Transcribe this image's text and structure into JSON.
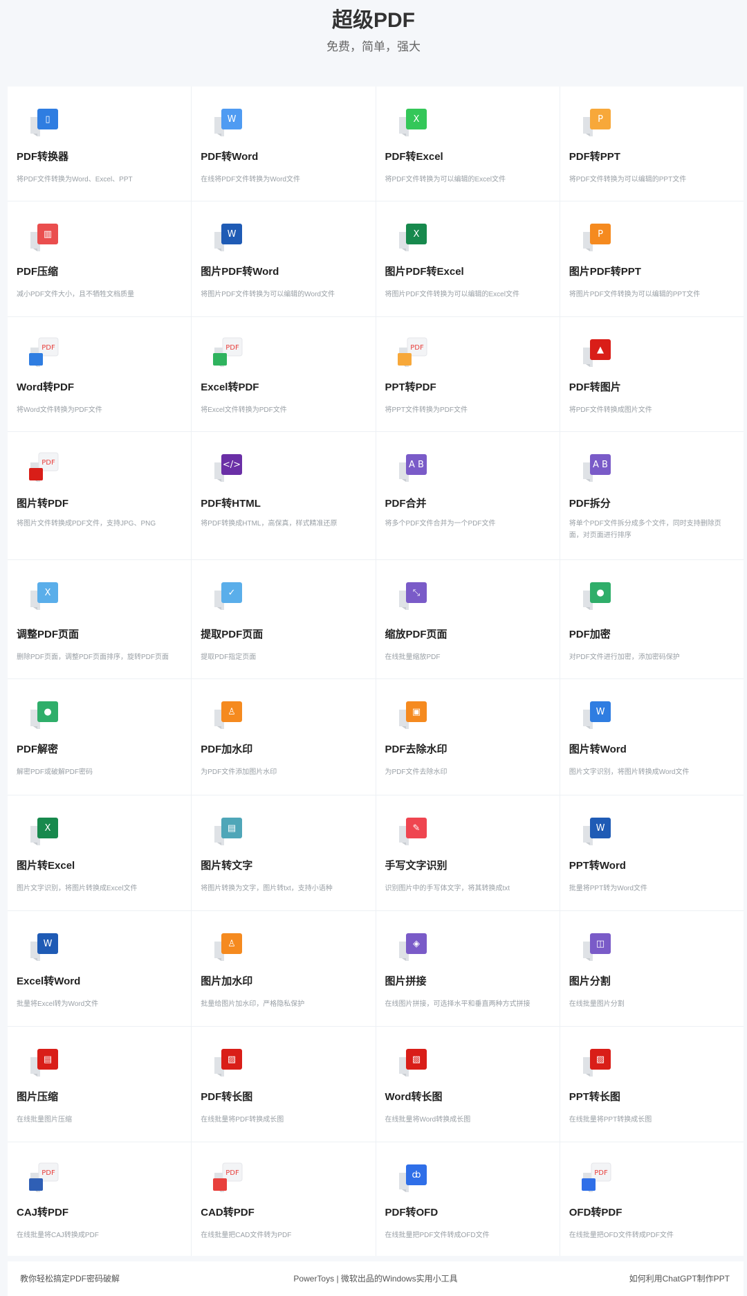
{
  "header": {
    "title": "超级PDF",
    "subtitle": "免费，简单，强大"
  },
  "tools": [
    {
      "key": "pdf-converter",
      "title": "PDF转换器",
      "desc": "将PDF文件转换为Word、Excel、PPT",
      "icon": "office-icon",
      "color": "#2f7de1",
      "glyph": "▯"
    },
    {
      "key": "pdf-to-word",
      "title": "PDF转Word",
      "desc": "在线将PDF文件转换为Word文件",
      "icon": "word-icon",
      "color": "#4f9bf2",
      "glyph": "W"
    },
    {
      "key": "pdf-to-excel",
      "title": "PDF转Excel",
      "desc": "将PDF文件转换为可以编辑的Excel文件",
      "icon": "excel-icon",
      "color": "#34c759",
      "glyph": "X"
    },
    {
      "key": "pdf-to-ppt",
      "title": "PDF转PPT",
      "desc": "将PDF文件转换为可以编辑的PPT文件",
      "icon": "ppt-icon",
      "color": "#f7a83a",
      "glyph": "P"
    },
    {
      "key": "pdf-compress",
      "title": "PDF压缩",
      "desc": "减小PDF文件大小，且不牺牲文档质量",
      "icon": "compress-icon",
      "color": "#ea4e4e",
      "glyph": "▥"
    },
    {
      "key": "image-pdf-to-word",
      "title": "图片PDF转Word",
      "desc": "将图片PDF文件转换为可以编辑的Word文件",
      "icon": "word-icon",
      "color": "#1f5bb5",
      "glyph": "W"
    },
    {
      "key": "image-pdf-to-excel",
      "title": "图片PDF转Excel",
      "desc": "将图片PDF文件转换为可以编辑的Excel文件",
      "icon": "excel-icon",
      "color": "#17894d",
      "glyph": "X"
    },
    {
      "key": "image-pdf-to-ppt",
      "title": "图片PDF转PPT",
      "desc": "将图片PDF文件转换为可以编辑的PPT文件",
      "icon": "ppt-icon",
      "color": "#f58a1f",
      "glyph": "P"
    },
    {
      "key": "word-to-pdf",
      "title": "Word转PDF",
      "desc": "将Word文件转换为PDF文件",
      "icon": "pdf-badge-icon",
      "color": "#2f7de1",
      "glyph": "PDF"
    },
    {
      "key": "excel-to-pdf",
      "title": "Excel转PDF",
      "desc": "将Excel文件转换为PDF文件",
      "icon": "pdf-badge-icon",
      "color": "#2fb35e",
      "glyph": "PDF"
    },
    {
      "key": "ppt-to-pdf",
      "title": "PPT转PDF",
      "desc": "将PPT文件转换为PDF文件",
      "icon": "pdf-badge-icon",
      "color": "#f7a83a",
      "glyph": "PDF"
    },
    {
      "key": "pdf-to-image",
      "title": "PDF转图片",
      "desc": "将PDF文件转换成图片文件",
      "icon": "image-icon",
      "color": "#d91e18",
      "glyph": "▲"
    },
    {
      "key": "image-to-pdf",
      "title": "图片转PDF",
      "desc": "将图片文件转换成PDF文件，支持JPG、PNG",
      "icon": "pdf-badge-icon",
      "color": "#d91e18",
      "glyph": "PDF"
    },
    {
      "key": "pdf-to-html",
      "title": "PDF转HTML",
      "desc": "将PDF转换成HTML，高保真，样式精准还原",
      "icon": "code-icon",
      "color": "#6a2fa6",
      "glyph": "</>"
    },
    {
      "key": "pdf-merge",
      "title": "PDF合并",
      "desc": "将多个PDF文件合并为一个PDF文件",
      "icon": "merge-icon",
      "color": "#7a5bc8",
      "glyph": "A B"
    },
    {
      "key": "pdf-split",
      "title": "PDF拆分",
      "desc": "将单个PDF文件拆分成多个文件，同时支持删除页面，对页面进行排序",
      "icon": "split-icon",
      "color": "#7a5bc8",
      "glyph": "A B"
    },
    {
      "key": "adjust-pdf-pages",
      "title": "调整PDF页面",
      "desc": "删除PDF页面，调整PDF页面排序，旋转PDF页面",
      "icon": "adjust-pages-icon",
      "color": "#5aaeea",
      "glyph": "X"
    },
    {
      "key": "extract-pdf-pages",
      "title": "提取PDF页面",
      "desc": "提取PDF指定页面",
      "icon": "extract-pages-icon",
      "color": "#5aaeea",
      "glyph": "✓"
    },
    {
      "key": "resize-pdf-pages",
      "title": "缩放PDF页面",
      "desc": "在线批量缩放PDF",
      "icon": "shrink-icon",
      "color": "#7a5bc8",
      "glyph": "⤡"
    },
    {
      "key": "pdf-encrypt",
      "title": "PDF加密",
      "desc": "对PDF文件进行加密，添加密码保护",
      "icon": "shield-icon",
      "color": "#2fae6a",
      "glyph": "●"
    },
    {
      "key": "pdf-decrypt",
      "title": "PDF解密",
      "desc": "解密PDF或破解PDF密码",
      "icon": "unlock-icon",
      "color": "#2fae6a",
      "glyph": "●"
    },
    {
      "key": "pdf-watermark",
      "title": "PDF加水印",
      "desc": "为PDF文件添加图片水印",
      "icon": "stamp-icon",
      "color": "#f58a1f",
      "glyph": "♙"
    },
    {
      "key": "pdf-remove-watermark",
      "title": "PDF去除水印",
      "desc": "为PDF文件去除水印",
      "icon": "eraser-icon",
      "color": "#f58a1f",
      "glyph": "▣"
    },
    {
      "key": "image-to-word",
      "title": "图片转Word",
      "desc": "图片文字识别，将图片转换成Word文件",
      "icon": "word-icon",
      "color": "#2f7de1",
      "glyph": "W"
    },
    {
      "key": "image-to-excel",
      "title": "图片转Excel",
      "desc": "图片文字识别，将图片转换成Excel文件",
      "icon": "excel-icon",
      "color": "#17894d",
      "glyph": "X"
    },
    {
      "key": "image-to-text",
      "title": "图片转文字",
      "desc": "将图片转换为文字，图片转txt，支持小语种",
      "icon": "text-doc-icon",
      "color": "#4fa6b8",
      "glyph": "▤"
    },
    {
      "key": "handwriting-ocr",
      "title": "手写文字识别",
      "desc": "识别图片中的手写体文字，将其转换成txt",
      "icon": "pen-icon",
      "color": "#ef4550",
      "glyph": "✎"
    },
    {
      "key": "ppt-to-word",
      "title": "PPT转Word",
      "desc": "批量将PPT转为Word文件",
      "icon": "word-icon",
      "color": "#1f5bb5",
      "glyph": "W"
    },
    {
      "key": "excel-to-word",
      "title": "Excel转Word",
      "desc": "批量将Excel转为Word文件",
      "icon": "word-icon",
      "color": "#1f5bb5",
      "glyph": "W"
    },
    {
      "key": "image-watermark",
      "title": "图片加水印",
      "desc": "批量给图片加水印，严格隐私保护",
      "icon": "stamp-icon",
      "color": "#f58a1f",
      "glyph": "♙"
    },
    {
      "key": "image-stitch",
      "title": "图片拼接",
      "desc": "在线图片拼接，可选择水平和垂直两种方式拼接",
      "icon": "stitch-icon",
      "color": "#7a5bc8",
      "glyph": "◈"
    },
    {
      "key": "image-split",
      "title": "图片分割",
      "desc": "在线批量图片分割",
      "icon": "split-image-icon",
      "color": "#7a5bc8",
      "glyph": "◫"
    },
    {
      "key": "image-compress",
      "title": "图片压缩",
      "desc": "在线批量图片压缩",
      "icon": "compress-icon",
      "color": "#d91e18",
      "glyph": "▤"
    },
    {
      "key": "pdf-to-long-image",
      "title": "PDF转长图",
      "desc": "在线批量将PDF转换成长图",
      "icon": "long-image-icon",
      "color": "#d91e18",
      "glyph": "▨"
    },
    {
      "key": "word-to-long-image",
      "title": "Word转长图",
      "desc": "在线批量将Word转换成长图",
      "icon": "long-image-icon",
      "color": "#d91e18",
      "glyph": "▨"
    },
    {
      "key": "ppt-to-long-image",
      "title": "PPT转长图",
      "desc": "在线批量将PPT转换成长图",
      "icon": "long-image-icon",
      "color": "#d91e18",
      "glyph": "▨"
    },
    {
      "key": "caj-to-pdf",
      "title": "CAJ转PDF",
      "desc": "在线批量将CAJ转换成PDF",
      "icon": "pdf-badge-icon",
      "color": "#2f5fb5",
      "glyph": "PDF"
    },
    {
      "key": "cad-to-pdf",
      "title": "CAD转PDF",
      "desc": "在线批量把CAD文件转为PDF",
      "icon": "pdf-badge-icon",
      "color": "#e8403c",
      "glyph": "PDF"
    },
    {
      "key": "pdf-to-ofd",
      "title": "PDF转OFD",
      "desc": "在线批量把PDF文件转成OFD文件",
      "icon": "ofd-icon",
      "color": "#2f6fe8",
      "glyph": "ȸ"
    },
    {
      "key": "ofd-to-pdf",
      "title": "OFD转PDF",
      "desc": "在线批量把OFD文件转成PDF文件",
      "icon": "pdf-badge-icon",
      "color": "#2f6fe8",
      "glyph": "PDF"
    }
  ],
  "footer": {
    "left": "教你轻松搞定PDF密码破解",
    "center": "PowerToys | 微软出品的Windows实用小工具",
    "right": "如何利用ChatGPT制作PPT"
  }
}
